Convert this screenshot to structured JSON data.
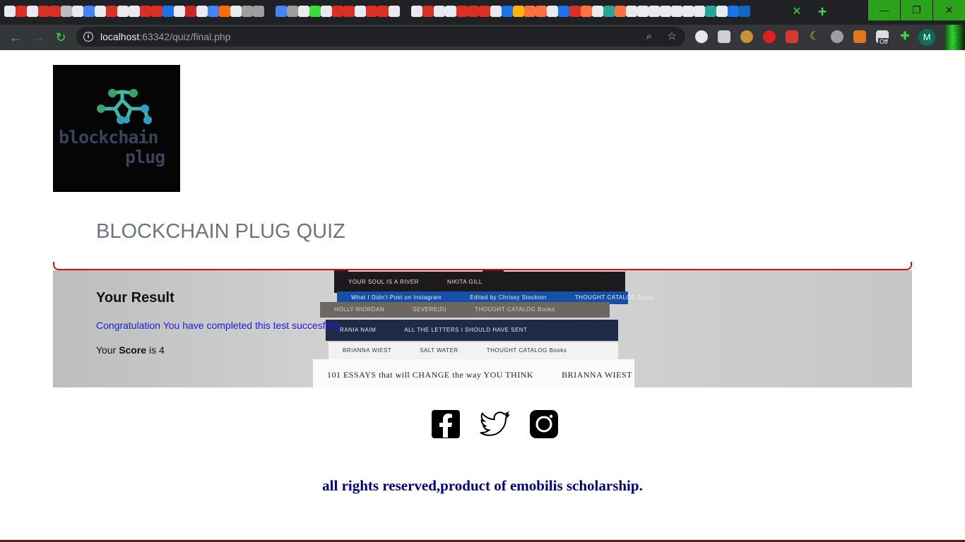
{
  "browser": {
    "url_host": "localhost",
    "url_rest": ":63342/quiz/final.php",
    "profile_initial": "M",
    "ext_badge": "Off"
  },
  "page": {
    "logo_line1": "blockchain",
    "logo_line2": "plug",
    "quiz_title": "BLOCKCHAIN PLUG QUIZ",
    "result_heading": "Your Result",
    "congrats_text": "Congratulation You have completed this test succesfully",
    "score_prefix": "Your ",
    "score_label": "Score",
    "score_suffix": " is 4",
    "footer_text": "all rights reserved,product of emobilis scholarship."
  },
  "books": [
    {
      "a": "YOUR SOUL IS A RIVER",
      "b": "NIKITA GILL"
    },
    {
      "a": "What I Didn't Post on Instagram",
      "b": "Edited by Chrissy Stockton",
      "c": "THOUGHT CATALOG Books"
    },
    {
      "a": "HOLLY RIORDAN",
      "b": "SEVERE(D)",
      "c": "THOUGHT CATALOG Books"
    },
    {
      "a": "RANIA NAIM",
      "b": "ALL THE LETTERS I SHOULD HAVE SENT"
    },
    {
      "a": "BRIANNA WIEST",
      "b": "SALT WATER",
      "c": "THOUGHT CATALOG Books"
    },
    {
      "a": "101 ESSAYS that will CHANGE the way YOU THINK",
      "b": "BRIANNA WIEST"
    }
  ],
  "social": [
    "facebook-icon",
    "twitter-icon",
    "instagram-icon"
  ],
  "colors": {
    "accent_green": "#3ddc3d",
    "title_gray": "#6c757d",
    "header_red": "#cc1111",
    "link_blue": "#1a1ae6",
    "footer_navy": "#000080"
  }
}
